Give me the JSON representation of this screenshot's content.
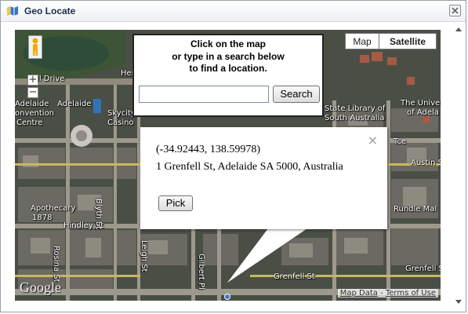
{
  "window": {
    "title": "Geo Locate"
  },
  "map": {
    "type_controls": {
      "map_label": "Map",
      "satellite_label": "Satellite",
      "selected": "Satellite"
    },
    "zoom_in_label": "+",
    "zoom_out_label": "−",
    "street_labels": {
      "festival_drive": "ival Drive",
      "adelaide_convention": "Adelaide",
      "convention": "onvention",
      "centre": "Centre",
      "adelaide": "Adelaide",
      "skycity": "Skycity",
      "casino": "Casino",
      "heimat": "Hei",
      "state_library": "State Library of",
      "south_australia": "South Australia",
      "university_1": "The Univers",
      "university_2": "of Adela",
      "terrace": "Tce",
      "austin": "Austin St",
      "rundle": "Rundle Mal",
      "apothecary_1": "Apothecary",
      "apothecary_2": "1878",
      "hindley": "Hindley St",
      "grenfell": "Grenfell St",
      "grenfell_right": "Grenfell St",
      "blyth": "Blyth St",
      "leigh": "Leigh St",
      "gilbert": "Gilbert Pl",
      "rosina": "Rosina St"
    },
    "google_logo": "Google",
    "map_data_link": "Map Data",
    "terms_link": "Terms of Use",
    "terms_separator": " - "
  },
  "search_panel": {
    "line1": "Click on the map",
    "line2": "or type in a search below",
    "line3": "to find a location.",
    "input_value": "",
    "button_label": "Search"
  },
  "info_window": {
    "coordinates": "(-34.92443, 138.59978)",
    "address": "1 Grenfell St, Adelaide SA 5000, Australia",
    "pick_label": "Pick",
    "close_symbol": "×"
  }
}
